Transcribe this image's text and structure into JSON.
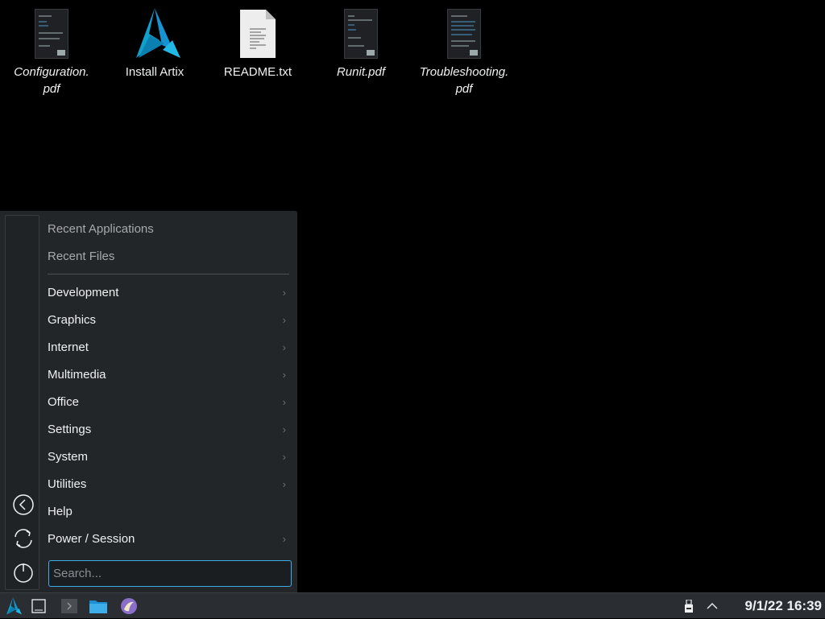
{
  "desktop": {
    "icons": [
      {
        "label": "Configuration.\npdf",
        "line1": "Configuration.",
        "line2": "pdf",
        "type": "pdf"
      },
      {
        "label": "Install Artix",
        "line1": "Install Artix",
        "line2": "",
        "type": "app"
      },
      {
        "label": "README.txt",
        "line1": "README.txt",
        "line2": "",
        "type": "text"
      },
      {
        "label": "Runit.pdf",
        "line1": "Runit.pdf",
        "line2": "",
        "type": "pdf"
      },
      {
        "label": "Troubleshooting.\npdf",
        "line1": "Troubleshooting.",
        "line2": "pdf",
        "type": "pdf"
      }
    ]
  },
  "menu": {
    "recent": [
      "Recent Applications",
      "Recent Files"
    ],
    "categories": [
      {
        "label": "Development",
        "submenu": true
      },
      {
        "label": "Graphics",
        "submenu": true
      },
      {
        "label": "Internet",
        "submenu": true
      },
      {
        "label": "Multimedia",
        "submenu": true
      },
      {
        "label": "Office",
        "submenu": true
      },
      {
        "label": "Settings",
        "submenu": true
      },
      {
        "label": "System",
        "submenu": true
      },
      {
        "label": "Utilities",
        "submenu": true
      },
      {
        "label": "Help",
        "submenu": false
      },
      {
        "label": "Power / Session",
        "submenu": true
      }
    ],
    "sidebar_buttons": [
      "back-icon",
      "switch-user-icon",
      "power-icon"
    ],
    "search": {
      "placeholder": "Search...",
      "value": ""
    },
    "chevron": "›"
  },
  "taskbar": {
    "launchers": [
      "artix-menu",
      "show-desktop",
      "terminal",
      "file-manager",
      "browser"
    ],
    "tray": {
      "usb": "removable-device-icon",
      "expand": "tray-expand-icon"
    },
    "clock": "9/1/22 16:39"
  },
  "colors": {
    "accent": "#3daee9",
    "artix_blue": "#10a0cc",
    "panel": "#2a2e32",
    "menu_bg": "#232629"
  }
}
